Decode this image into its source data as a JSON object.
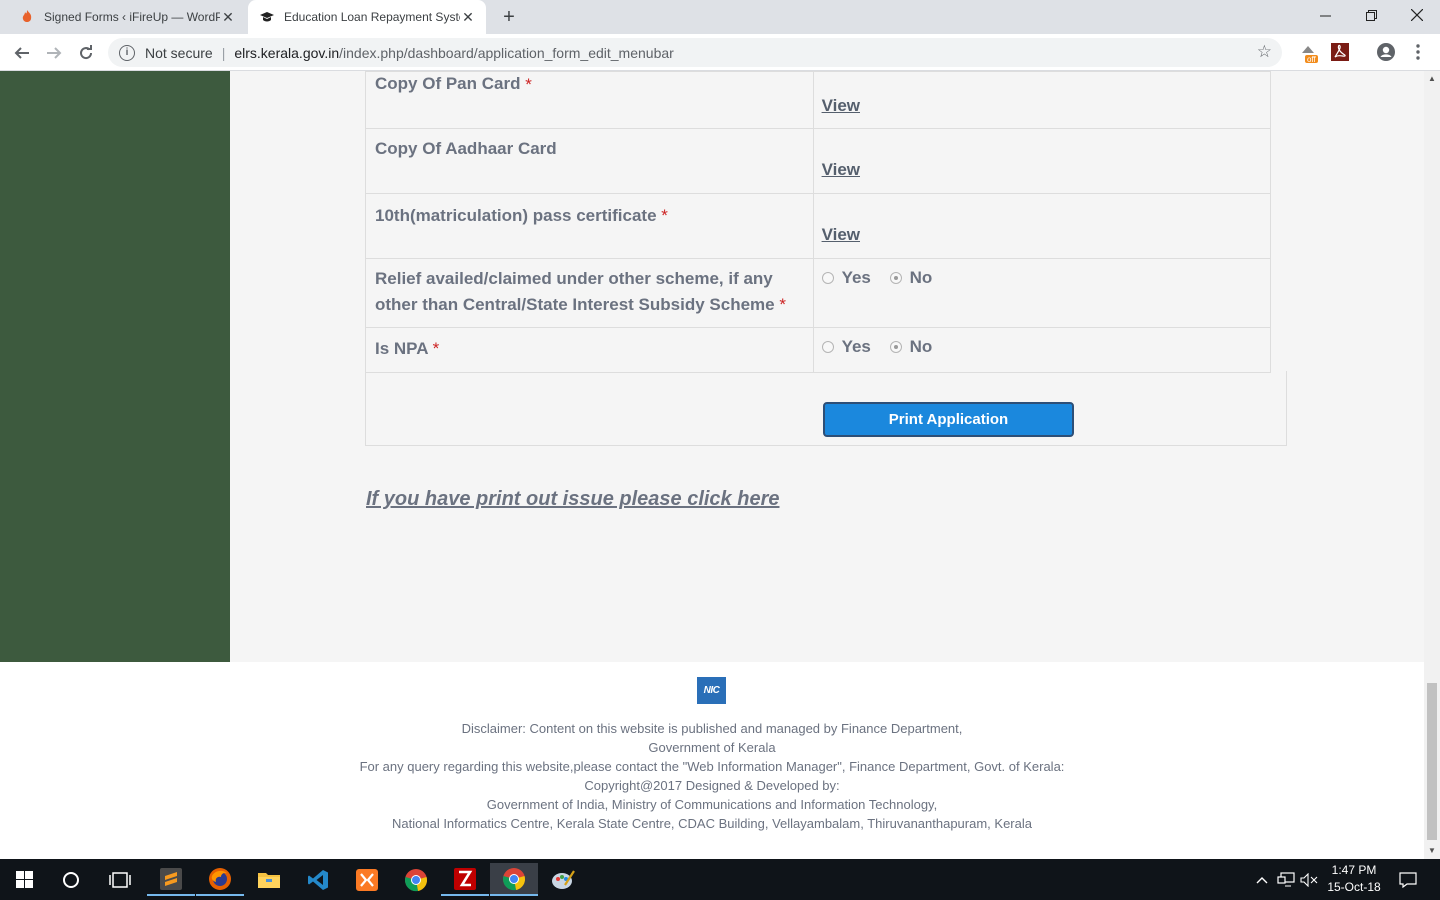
{
  "browser": {
    "tabs": [
      {
        "title": "Signed Forms ‹ iFireUp — WordPress",
        "active": false
      },
      {
        "title": "Education Loan Repayment System",
        "active": true
      }
    ],
    "address": {
      "security_label": "Not secure",
      "host": "elrs.kerala.gov.in",
      "path": "/index.php/dashboard/application_form_edit_menubar"
    },
    "extension_badge": "off"
  },
  "form": {
    "rows": [
      {
        "label": "Copy Of Pan Card",
        "required": "*",
        "link": "View"
      },
      {
        "label": "Copy Of Aadhaar Card",
        "required": "",
        "link": "View"
      },
      {
        "label": "10th(matriculation) pass certificate",
        "required": "*",
        "link": "View"
      },
      {
        "label_line1": "Relief availed/claimed under other scheme, if any",
        "label_line2": "other than Central/State Interest Subsidy Scheme",
        "required": "*",
        "opt_yes": "Yes",
        "opt_no": "No",
        "selected": "No"
      },
      {
        "label": "Is NPA",
        "required": "*",
        "opt_yes": "Yes",
        "opt_no": "No",
        "selected": "No"
      }
    ],
    "print_button": "Print Application",
    "print_issue_link": "If you have print out issue please click here"
  },
  "footer": {
    "logo_text": "NIC",
    "lines": [
      "Disclaimer: Content on this website is published and managed by Finance Department,",
      "Government of Kerala",
      "For any query regarding this website,please contact the \"Web Information Manager\", Finance Department, Govt. of Kerala:",
      "Copyright@2017 Designed & Developed by:",
      "Government of India, Ministry of Communications and Information Technology,",
      "National Informatics Centre, Kerala State Centre, CDAC Building, Vellayambalam, Thiruvananthapuram, Kerala"
    ]
  },
  "taskbar": {
    "time": "1:47 PM",
    "date": "15-Oct-18"
  },
  "colors": {
    "sidebar": "#3d5a3e",
    "button": "#1b88dd",
    "required": "#cc2222",
    "text": "#6b7280"
  }
}
